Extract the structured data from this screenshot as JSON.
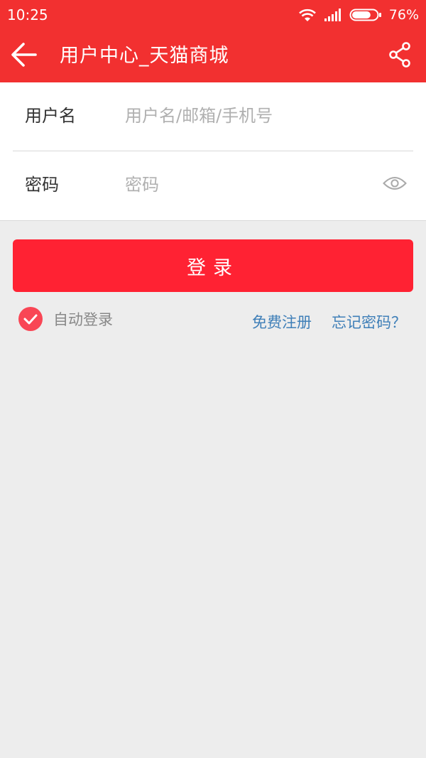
{
  "status_bar": {
    "time": "10:25",
    "battery_percent": "76%",
    "battery_level": 0.76,
    "icons": [
      "wifi-icon",
      "signal-icon",
      "battery-icon"
    ]
  },
  "app_bar": {
    "title": "用户中心_天猫商城",
    "back_icon": "arrow-left-icon",
    "share_icon": "share-icon"
  },
  "form": {
    "username": {
      "label": "用户名",
      "placeholder": "用户名/邮箱/手机号",
      "value": ""
    },
    "password": {
      "label": "密码",
      "placeholder": "密码",
      "value": "",
      "toggle_icon": "eye-icon"
    }
  },
  "login_button": {
    "label": "登录"
  },
  "options": {
    "auto_login_label": "自动登录",
    "auto_login_checked": true,
    "register_link": "免费注册",
    "forgot_link": "忘记密码？"
  },
  "colors": {
    "brand_red": "#f23030",
    "button_red": "#ff2233",
    "link_blue": "#3f7fb8",
    "background": "#ededed"
  }
}
